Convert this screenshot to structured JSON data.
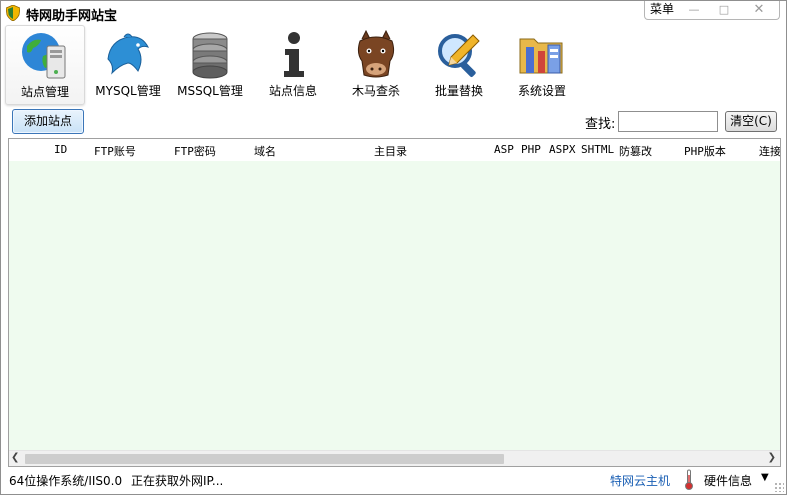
{
  "window": {
    "title": "特网助手网站宝",
    "controls": {
      "menu": "菜单",
      "minimize": "—",
      "maximize": "□",
      "close": "✕"
    }
  },
  "toolbar": {
    "items": [
      {
        "label": "站点管理",
        "icon": "globe-server-icon",
        "active": true
      },
      {
        "label": "MYSQL管理",
        "icon": "dolphin-icon",
        "active": false
      },
      {
        "label": "MSSQL管理",
        "icon": "database-icon",
        "active": false
      },
      {
        "label": "站点信息",
        "icon": "info-icon",
        "active": false
      },
      {
        "label": "木马查杀",
        "icon": "horse-icon",
        "active": false
      },
      {
        "label": "批量替换",
        "icon": "magnifier-pencil-icon",
        "active": false
      },
      {
        "label": "系统设置",
        "icon": "tools-settings-icon",
        "active": false
      }
    ]
  },
  "actions": {
    "add_site": "添加站点",
    "search_label": "查找:",
    "search_value": "",
    "clear": "清空(C)"
  },
  "grid": {
    "columns": [
      "ID",
      "FTP账号",
      "FTP密码",
      "域名",
      "主目录",
      "ASP",
      "PHP",
      "ASPX",
      "SHTML",
      "防篡改",
      "PHP版本",
      "连接"
    ],
    "rows": []
  },
  "status": {
    "os": "64位操作系统/IIS0.0",
    "message": "正在获取外网IP...",
    "cloud_link": "特网云主机",
    "hardware": "硬件信息",
    "dropdown": "▼"
  },
  "colors": {
    "grid_background": "#effbef",
    "link": "#1a5fb4",
    "button_border": "#3b76b8"
  }
}
